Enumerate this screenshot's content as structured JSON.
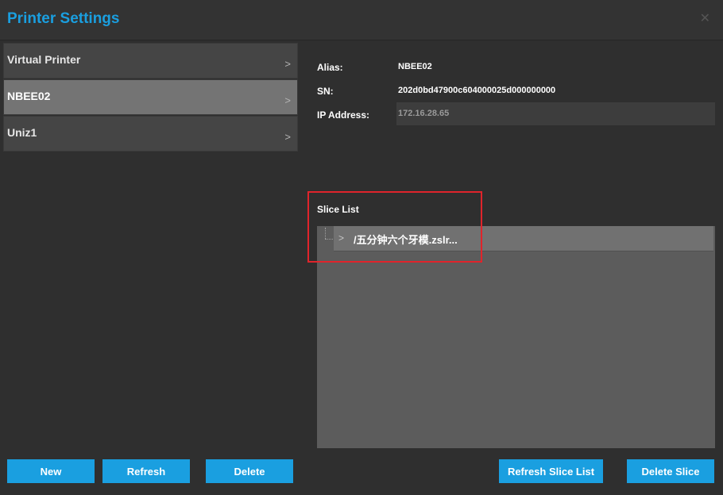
{
  "window": {
    "title": "Printer Settings",
    "close_icon": "close-icon",
    "close_glyph": "✕"
  },
  "printers": {
    "items": [
      {
        "name": "Virtual Printer",
        "selected": false
      },
      {
        "name": "NBEE02",
        "selected": true
      },
      {
        "name": "Uniz1",
        "selected": false
      }
    ],
    "chevron_glyph": ">"
  },
  "details": {
    "alias_label": "Alias:",
    "alias_value": "NBEE02",
    "sn_label": "SN:",
    "sn_value": "202d0bd47900c604000025d000000000",
    "ip_label": "IP Address:",
    "ip_value": "172.16.28.65"
  },
  "slice_list": {
    "label": "Slice List",
    "items": [
      {
        "name": "/五分钟六个牙模.zslr..."
      }
    ],
    "chevron_glyph": ">"
  },
  "buttons": {
    "new": "New",
    "refresh": "Refresh",
    "delete": "Delete",
    "refresh_slice_list": "Refresh Slice List",
    "delete_slice": "Delete Slice"
  },
  "colors": {
    "accent": "#1a9fe0",
    "highlight": "#e0242b",
    "background": "#2f2f2f",
    "selected_item": "#747474"
  }
}
